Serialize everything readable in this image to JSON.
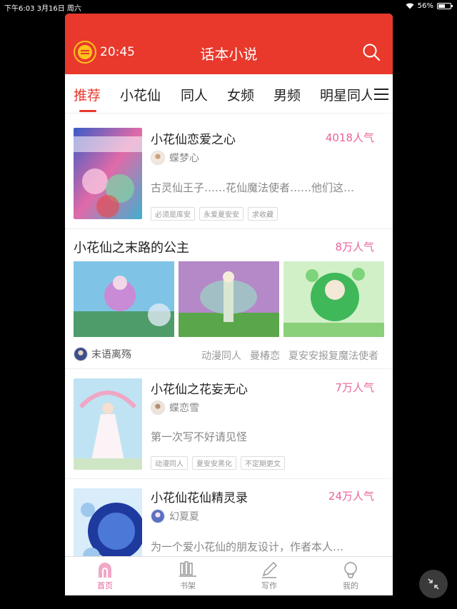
{
  "status_bar": {
    "time_date": "下午6:03   3月16日 周六",
    "battery": "56%",
    "battery_level": 0.56
  },
  "header": {
    "timer": "20:45",
    "title": "话本小说"
  },
  "tabs": [
    "推荐",
    "小花仙",
    "同人",
    "女频",
    "男频",
    "明星同人"
  ],
  "books": [
    {
      "title": "小花仙恋爱之心",
      "popularity": "4018人气",
      "author": "蝶梦心",
      "description": "古灵仙王子……花仙魔法使者……他们这…",
      "tags": [
        "必须是库安",
        "永爱夏安安",
        "求收藏"
      ]
    },
    {
      "title": "小花仙之末路的公主",
      "popularity": "8万人气",
      "author": "末语离殇",
      "tags": [
        "动漫同人",
        "曼椿恋",
        "夏安安报复魔法使者"
      ]
    },
    {
      "title": "小花仙之花妄无心",
      "popularity": "7万人气",
      "author": "蝶恋雪",
      "description": "第一次写不好请见怪",
      "tags": [
        "动漫同人",
        "夏安安黑化",
        "不定期更文"
      ]
    },
    {
      "title": "小花仙花仙精灵录",
      "popularity": "24万人气",
      "author": "幻夏夏",
      "description": "为一个爱小花仙的朋友设计，作者本人…"
    }
  ],
  "bottom_nav": [
    "首页",
    "书架",
    "写作",
    "我的"
  ],
  "colors": {
    "brand": "#e8392c",
    "popularity": "#e8639b",
    "coin": "#ffc21a"
  }
}
